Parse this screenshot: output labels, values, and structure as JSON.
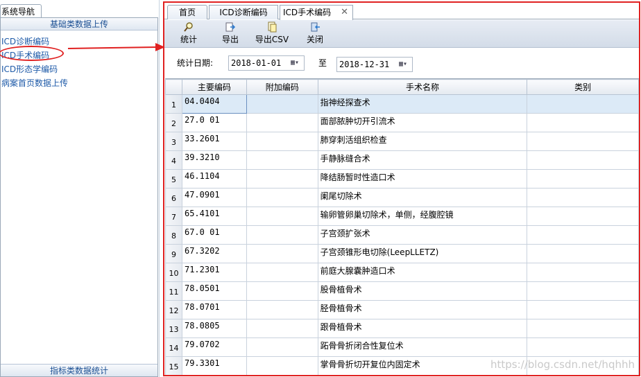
{
  "nav": {
    "tab_label": "系统导航",
    "section_top": "基础类数据上传",
    "items": [
      {
        "label": "ICD诊断编码"
      },
      {
        "label": "ICD手术编码"
      },
      {
        "label": "ICD形态学编码"
      },
      {
        "label": "病案首页数据上传"
      }
    ],
    "section_bottom": "指标类数据统计"
  },
  "tabs": [
    {
      "label": "首页"
    },
    {
      "label": "ICD诊断编码"
    },
    {
      "label": "ICD手术编码"
    }
  ],
  "tab_close_glyph": "✕",
  "toolbar": {
    "stat": {
      "label": "统计",
      "icon": "magnifier-icon"
    },
    "export": {
      "label": "导出",
      "icon": "export-icon"
    },
    "export_csv": {
      "label": "导出CSV",
      "icon": "csv-icon"
    },
    "close": {
      "label": "关闭",
      "icon": "close-door-icon"
    }
  },
  "filter": {
    "date_label": "统计日期:",
    "from": "2018-01-01",
    "to_label": "至",
    "to": "2018-12-31"
  },
  "grid": {
    "columns": [
      "主要编码",
      "附加编码",
      "手术名称",
      "类别"
    ],
    "rows": [
      {
        "n": "1",
        "code": "04.0404",
        "extra": "",
        "name": "指神经探查术",
        "type": ""
      },
      {
        "n": "2",
        "code": "27.0 01",
        "extra": "",
        "name": "面部脓肿切开引流术",
        "type": ""
      },
      {
        "n": "3",
        "code": "33.2601",
        "extra": "",
        "name": "肺穿刺活组织检查",
        "type": ""
      },
      {
        "n": "4",
        "code": "39.3210",
        "extra": "",
        "name": "手静脉缝合术",
        "type": ""
      },
      {
        "n": "5",
        "code": "46.1104",
        "extra": "",
        "name": "降结肠暂时性造口术",
        "type": ""
      },
      {
        "n": "6",
        "code": "47.0901",
        "extra": "",
        "name": "阑尾切除术",
        "type": ""
      },
      {
        "n": "7",
        "code": "65.4101",
        "extra": "",
        "name": "输卵管卵巢切除术，单侧，经腹腔镜",
        "type": ""
      },
      {
        "n": "8",
        "code": "67.0 01",
        "extra": "",
        "name": "子宫颈扩张术",
        "type": ""
      },
      {
        "n": "9",
        "code": "67.3202",
        "extra": "",
        "name": "子宫颈锥形电切除(LeepLLETZ)",
        "type": ""
      },
      {
        "n": "10",
        "code": "71.2301",
        "extra": "",
        "name": "前庭大腺囊肿造口术",
        "type": ""
      },
      {
        "n": "11",
        "code": "78.0501",
        "extra": "",
        "name": "股骨植骨术",
        "type": ""
      },
      {
        "n": "12",
        "code": "78.0701",
        "extra": "",
        "name": "胫骨植骨术",
        "type": ""
      },
      {
        "n": "13",
        "code": "78.0805",
        "extra": "",
        "name": "跟骨植骨术",
        "type": ""
      },
      {
        "n": "14",
        "code": "79.0702",
        "extra": "",
        "name": "跖骨骨折闭合性复位术",
        "type": ""
      },
      {
        "n": "15",
        "code": "79.3301",
        "extra": "",
        "name": "掌骨骨折切开复位内固定术",
        "type": ""
      }
    ]
  },
  "watermark": "https://blog.csdn.net/hqhhh",
  "annotation_color": "#e02020"
}
